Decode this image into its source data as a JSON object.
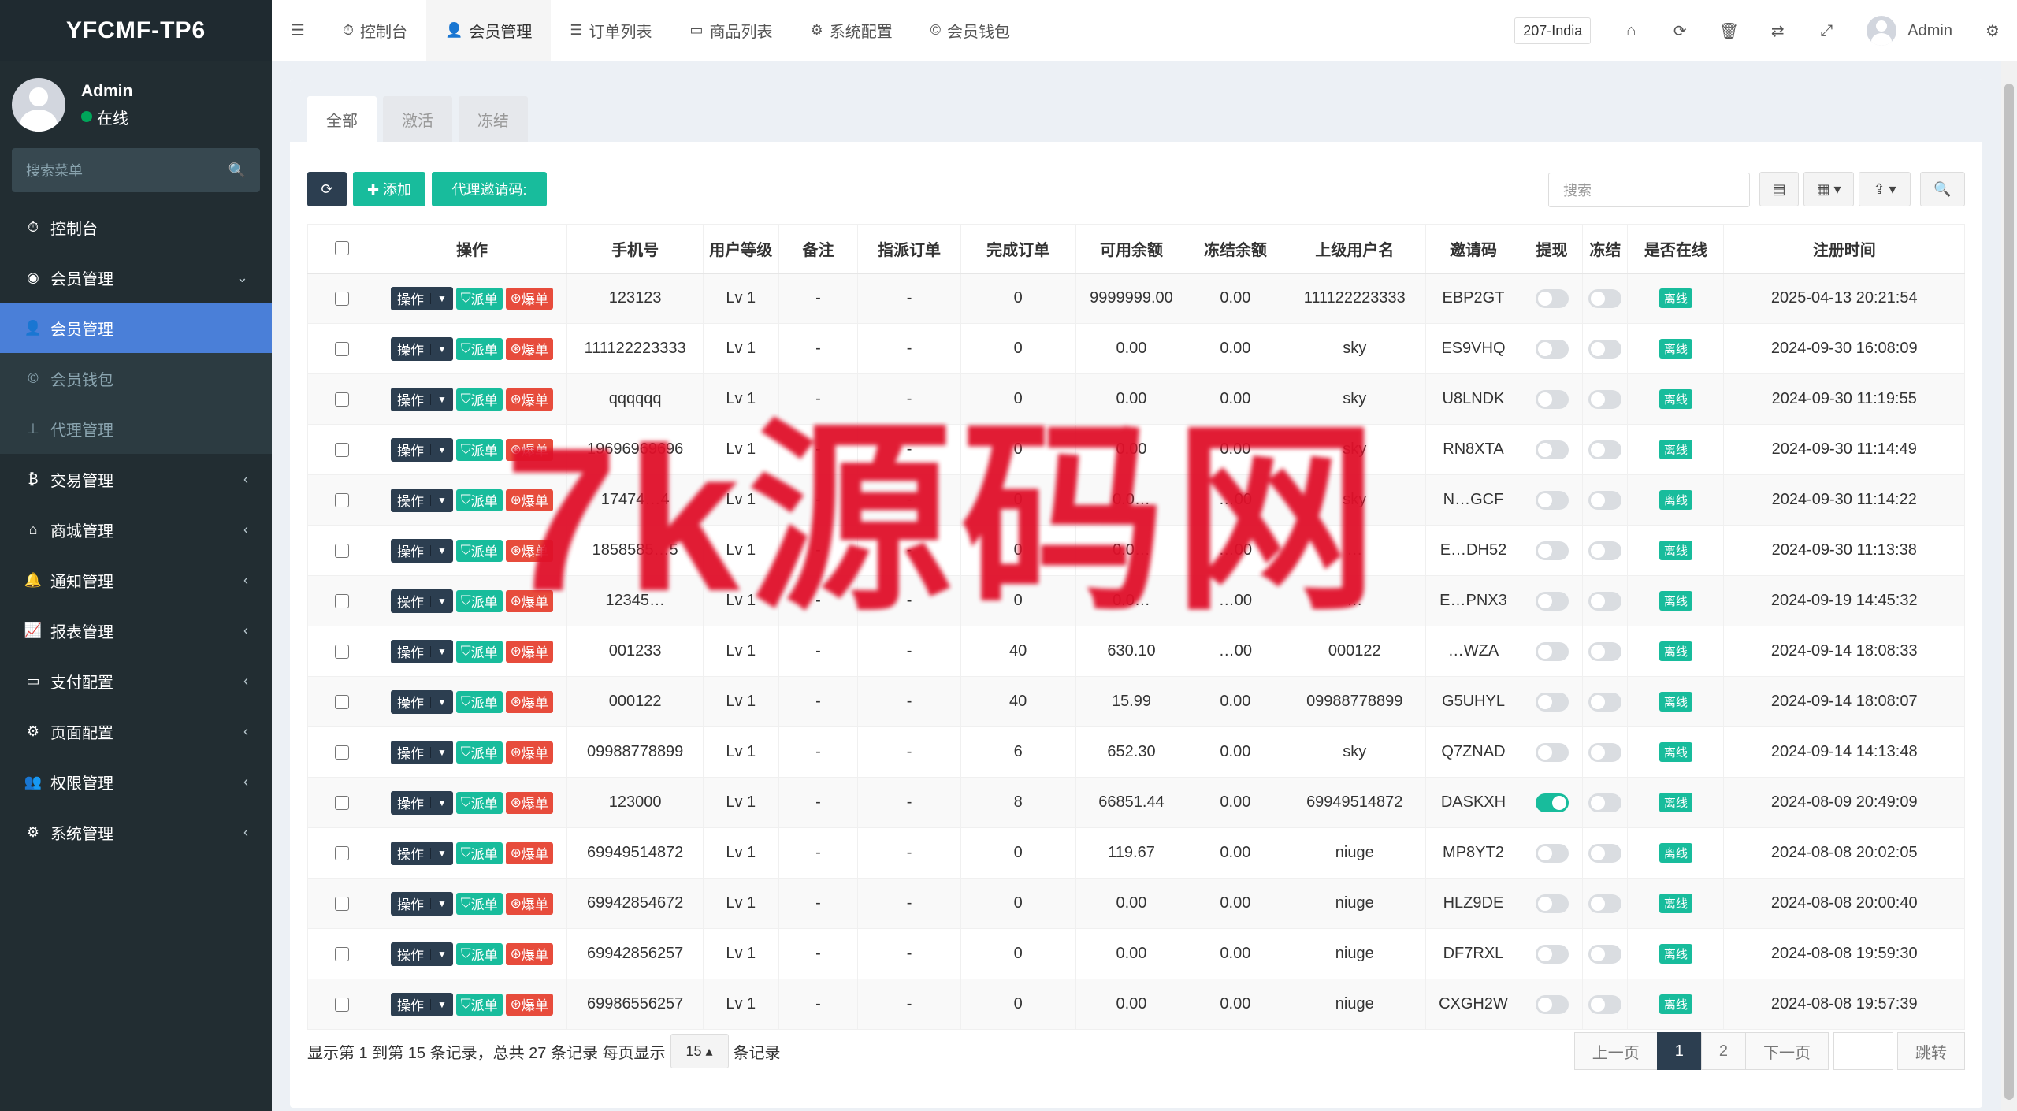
{
  "sidebar": {
    "logo": "YFCMF-TP6",
    "user": {
      "name": "Admin",
      "status": "在线"
    },
    "search_placeholder": "搜索菜单",
    "items": [
      {
        "label": "控制台",
        "icon": "dashboard-icon",
        "glyph": "⏱"
      },
      {
        "label": "会员管理",
        "icon": "user-circle-icon",
        "glyph": "◉",
        "caret": "⌄"
      },
      {
        "label": "会员管理",
        "icon": "user-icon",
        "glyph": "👤"
      },
      {
        "label": "会员钱包",
        "icon": "wallet-icon",
        "glyph": "©"
      },
      {
        "label": "代理管理",
        "icon": "sitemap-icon",
        "glyph": "⊥"
      },
      {
        "label": "交易管理",
        "icon": "bitcoin-icon",
        "glyph": "₿",
        "caret": "‹"
      },
      {
        "label": "商城管理",
        "icon": "home-icon",
        "glyph": "⌂",
        "caret": "‹"
      },
      {
        "label": "通知管理",
        "icon": "bell-icon",
        "glyph": "🔔",
        "caret": "‹"
      },
      {
        "label": "报表管理",
        "icon": "chart-icon",
        "glyph": "📈",
        "caret": "‹"
      },
      {
        "label": "支付配置",
        "icon": "card-icon",
        "glyph": "▭",
        "caret": "‹"
      },
      {
        "label": "页面配置",
        "icon": "gear-icon",
        "glyph": "⚙",
        "caret": "‹"
      },
      {
        "label": "权限管理",
        "icon": "users-icon",
        "glyph": "👥",
        "caret": "‹"
      },
      {
        "label": "系统管理",
        "icon": "gears-icon",
        "glyph": "⚙",
        "caret": "‹"
      }
    ]
  },
  "topbar": {
    "menu_icon": "☰",
    "tabs": [
      {
        "label": "控制台",
        "icon": "dashboard-icon",
        "glyph": "⏱"
      },
      {
        "label": "会员管理",
        "icon": "user-icon",
        "glyph": "👤"
      },
      {
        "label": "订单列表",
        "icon": "list-icon",
        "glyph": "☰"
      },
      {
        "label": "商品列表",
        "icon": "desktop-icon",
        "glyph": "▭"
      },
      {
        "label": "系统配置",
        "icon": "gear-icon",
        "glyph": "⚙"
      },
      {
        "label": "会员钱包",
        "icon": "wallet-icon",
        "glyph": "©"
      }
    ],
    "country": "207-India",
    "icons": [
      {
        "name": "home-icon",
        "glyph": "⌂"
      },
      {
        "name": "refresh-icon",
        "glyph": "⟳"
      },
      {
        "name": "trash-icon",
        "glyph": "🗑"
      },
      {
        "name": "translate-icon",
        "glyph": "⇄"
      },
      {
        "name": "fullscreen-icon",
        "glyph": "⤢"
      }
    ],
    "user": "Admin",
    "settings_glyph": "⚙"
  },
  "main": {
    "tabs": [
      "全部",
      "激活",
      "冻结"
    ],
    "toolbar": {
      "refresh": "⟳",
      "add": "✚ 添加",
      "invite": "代理邀请码:",
      "search_placeholder": "搜索",
      "view_toggle": "▤",
      "columns": "▦ ▾",
      "export": "⇪ ▾",
      "search_btn": "🔍"
    },
    "columns": [
      "操作",
      "手机号",
      "用户等级",
      "备注",
      "指派订单",
      "完成订单",
      "可用余额",
      "冻结余额",
      "上级用户名",
      "邀请码",
      "提现",
      "冻结",
      "是否在线",
      "注册时间"
    ],
    "row_ops": {
      "op": "操作",
      "pd": "派单",
      "bd": "爆单"
    },
    "rows": [
      {
        "phone": "123123",
        "level": "Lv 1",
        "note": "-",
        "assigned": "-",
        "done": "0",
        "balance": "9999999.00",
        "frozen": "0.00",
        "parent": "111122223333",
        "code": "EBP2GT",
        "withdraw": false,
        "freeze": false,
        "online": "离线",
        "time": "2025-04-13 20:21:54"
      },
      {
        "phone": "111122223333",
        "level": "Lv 1",
        "note": "-",
        "assigned": "-",
        "done": "0",
        "balance": "0.00",
        "frozen": "0.00",
        "parent": "sky",
        "code": "ES9VHQ",
        "withdraw": false,
        "freeze": false,
        "online": "离线",
        "time": "2024-09-30 16:08:09"
      },
      {
        "phone": "qqqqqq",
        "level": "Lv 1",
        "note": "-",
        "assigned": "-",
        "done": "0",
        "balance": "0.00",
        "frozen": "0.00",
        "parent": "sky",
        "code": "U8LNDK",
        "withdraw": false,
        "freeze": false,
        "online": "离线",
        "time": "2024-09-30 11:19:55"
      },
      {
        "phone": "19696969696",
        "level": "Lv 1",
        "note": "-",
        "assigned": "-",
        "done": "0",
        "balance": "0.00",
        "frozen": "0.00",
        "parent": "sky",
        "code": "RN8XTA",
        "withdraw": false,
        "freeze": false,
        "online": "离线",
        "time": "2024-09-30 11:14:49"
      },
      {
        "phone": "17474…4",
        "level": "Lv 1",
        "note": "-",
        "assigned": "-",
        "done": "0",
        "balance": "0.0…",
        "frozen": "…00",
        "parent": "sky",
        "code": "N…GCF",
        "withdraw": false,
        "freeze": false,
        "online": "离线",
        "time": "2024-09-30 11:14:22"
      },
      {
        "phone": "1858585…5",
        "level": "Lv 1",
        "note": "-",
        "assigned": "-",
        "done": "0",
        "balance": "0.0…",
        "frozen": "…00",
        "parent": "…",
        "code": "E…DH52",
        "withdraw": false,
        "freeze": false,
        "online": "离线",
        "time": "2024-09-30 11:13:38"
      },
      {
        "phone": "12345…",
        "level": "Lv 1",
        "note": "-",
        "assigned": "-",
        "done": "0",
        "balance": "0.0…",
        "frozen": "…00",
        "parent": "…",
        "code": "E…PNX3",
        "withdraw": false,
        "freeze": false,
        "online": "离线",
        "time": "2024-09-19 14:45:32"
      },
      {
        "phone": "001233",
        "level": "Lv 1",
        "note": "-",
        "assigned": "-",
        "done": "40",
        "balance": "630.10",
        "frozen": "…00",
        "parent": "000122",
        "code": "…WZA",
        "withdraw": false,
        "freeze": false,
        "online": "离线",
        "time": "2024-09-14 18:08:33"
      },
      {
        "phone": "000122",
        "level": "Lv 1",
        "note": "-",
        "assigned": "-",
        "done": "40",
        "balance": "15.99",
        "frozen": "0.00",
        "parent": "09988778899",
        "code": "G5UHYL",
        "withdraw": false,
        "freeze": false,
        "online": "离线",
        "time": "2024-09-14 18:08:07"
      },
      {
        "phone": "09988778899",
        "level": "Lv 1",
        "note": "-",
        "assigned": "-",
        "done": "6",
        "balance": "652.30",
        "frozen": "0.00",
        "parent": "sky",
        "code": "Q7ZNAD",
        "withdraw": false,
        "freeze": false,
        "online": "离线",
        "time": "2024-09-14 14:13:48"
      },
      {
        "phone": "123000",
        "level": "Lv 1",
        "note": "-",
        "assigned": "-",
        "done": "8",
        "balance": "66851.44",
        "frozen": "0.00",
        "parent": "69949514872",
        "code": "DASKXH",
        "withdraw": true,
        "freeze": false,
        "online": "离线",
        "time": "2024-08-09 20:49:09"
      },
      {
        "phone": "69949514872",
        "level": "Lv 1",
        "note": "-",
        "assigned": "-",
        "done": "0",
        "balance": "119.67",
        "frozen": "0.00",
        "parent": "niuge",
        "code": "MP8YT2",
        "withdraw": false,
        "freeze": false,
        "online": "离线",
        "time": "2024-08-08 20:02:05"
      },
      {
        "phone": "69942854672",
        "level": "Lv 1",
        "note": "-",
        "assigned": "-",
        "done": "0",
        "balance": "0.00",
        "frozen": "0.00",
        "parent": "niuge",
        "code": "HLZ9DE",
        "withdraw": false,
        "freeze": false,
        "online": "离线",
        "time": "2024-08-08 20:00:40"
      },
      {
        "phone": "69942856257",
        "level": "Lv 1",
        "note": "-",
        "assigned": "-",
        "done": "0",
        "balance": "0.00",
        "frozen": "0.00",
        "parent": "niuge",
        "code": "DF7RXL",
        "withdraw": false,
        "freeze": false,
        "online": "离线",
        "time": "2024-08-08 19:59:30"
      },
      {
        "phone": "69986556257",
        "level": "Lv 1",
        "note": "-",
        "assigned": "-",
        "done": "0",
        "balance": "0.00",
        "frozen": "0.00",
        "parent": "niuge",
        "code": "CXGH2W",
        "withdraw": false,
        "freeze": false,
        "online": "离线",
        "time": "2024-08-08 19:57:39"
      }
    ],
    "footer": {
      "info": "显示第 1 到第 15 条记录，总共 27 条记录 每页显示",
      "page_size": "15 ▴",
      "suffix": "条记录",
      "prev": "上一页",
      "pages": [
        "1",
        "2"
      ],
      "next": "下一页",
      "jump": "跳转"
    }
  },
  "watermark": "7k源码网",
  "colors": {
    "sidebar_bg": "#222d32",
    "active_menu": "#4a7fd8",
    "teal": "#18bc9c",
    "red": "#e74c3c",
    "dark_btn": "#2c3e50"
  }
}
